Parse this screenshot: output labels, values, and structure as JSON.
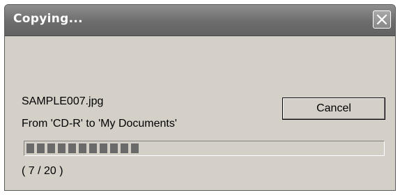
{
  "window": {
    "title": "Copying...",
    "close_icon": "close-x-icon"
  },
  "copy": {
    "filename": "SAMPLE007.jpg",
    "from_to": "From 'CD-R' to 'My Documents'",
    "counter": "( 7 / 20 )",
    "files_done": 7,
    "files_total": 20,
    "progress_fraction": 0.33
  },
  "buttons": {
    "cancel_label": "Cancel"
  },
  "colors": {
    "titlebar": "#6d6d6d",
    "dialog_bg": "#d4d0c8",
    "progress_block": "#6a6a6a"
  }
}
